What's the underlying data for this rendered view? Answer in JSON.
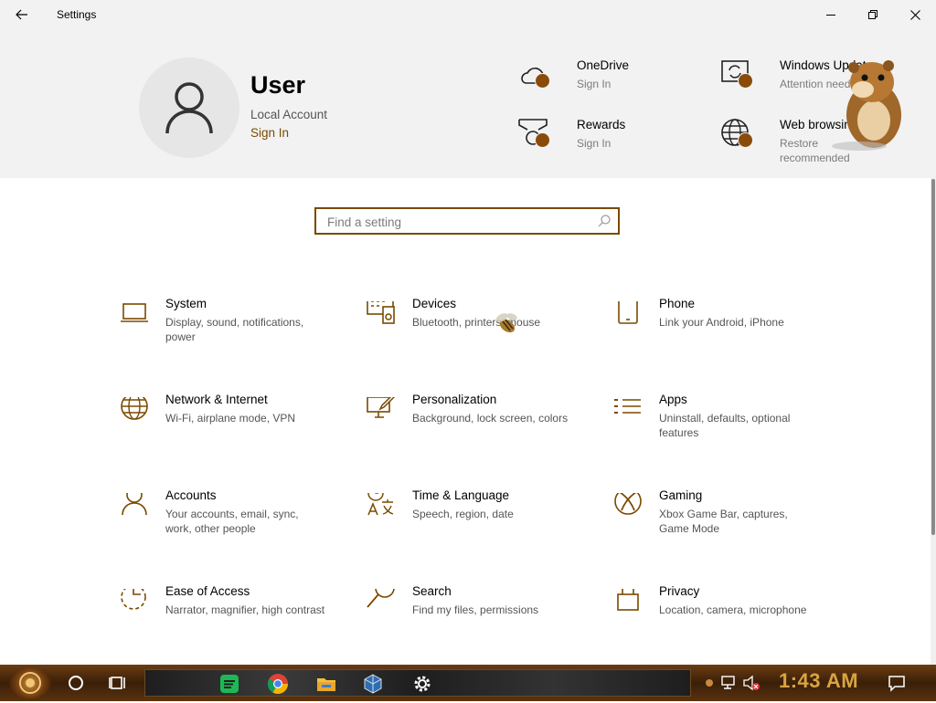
{
  "window": {
    "title": "Settings"
  },
  "user": {
    "name": "User",
    "account_type": "Local Account",
    "sign_in_label": "Sign In"
  },
  "quick_items": [
    {
      "title": "OneDrive",
      "subtitle": "Sign In",
      "icon": "onedrive-cloud-icon"
    },
    {
      "title": "Rewards",
      "subtitle": "Sign In",
      "icon": "rewards-trophy-icon"
    },
    {
      "title": "Windows Update",
      "subtitle": "Attention needed",
      "icon": "windows-update-icon"
    },
    {
      "title": "Web browsing",
      "subtitle": "Restore recommended",
      "icon": "globe-icon"
    }
  ],
  "search": {
    "placeholder": "Find a setting"
  },
  "categories": [
    {
      "title": "System",
      "desc": "Display, sound, notifications, power",
      "icon": "laptop-icon"
    },
    {
      "title": "Devices",
      "desc": "Bluetooth, printers, mouse",
      "icon": "devices-keyboard-speaker-icon"
    },
    {
      "title": "Phone",
      "desc": "Link your Android, iPhone",
      "icon": "phone-icon"
    },
    {
      "title": "Network & Internet",
      "desc": "Wi-Fi, airplane mode, VPN",
      "icon": "globe-icon"
    },
    {
      "title": "Personalization",
      "desc": "Background, lock screen, colors",
      "icon": "personalization-paint-icon"
    },
    {
      "title": "Apps",
      "desc": "Uninstall, defaults, optional features",
      "icon": "apps-list-icon"
    },
    {
      "title": "Accounts",
      "desc": "Your accounts, email, sync, work, other people",
      "icon": "person-icon"
    },
    {
      "title": "Time & Language",
      "desc": "Speech, region, date",
      "icon": "time-language-icon"
    },
    {
      "title": "Gaming",
      "desc": "Xbox Game Bar, captures, Game Mode",
      "icon": "xbox-icon"
    },
    {
      "title": "Ease of Access",
      "desc": "Narrator, magnifier, high contrast",
      "icon": "ease-of-access-icon"
    },
    {
      "title": "Search",
      "desc": "Find my files, permissions",
      "icon": "search-magnifier-icon"
    },
    {
      "title": "Privacy",
      "desc": "Location, camera, microphone",
      "icon": "lock-icon"
    }
  ],
  "taskbar": {
    "clock": "1:43 AM",
    "apps": [
      "spotify-icon",
      "chrome-icon",
      "file-explorer-icon",
      "virtualbox-icon",
      "settings-gear-icon"
    ]
  },
  "colors": {
    "accent": "#7a4a00",
    "badge": "#8a4b0a",
    "header_bg": "#f2f2f2",
    "clock": "#d9a441"
  }
}
